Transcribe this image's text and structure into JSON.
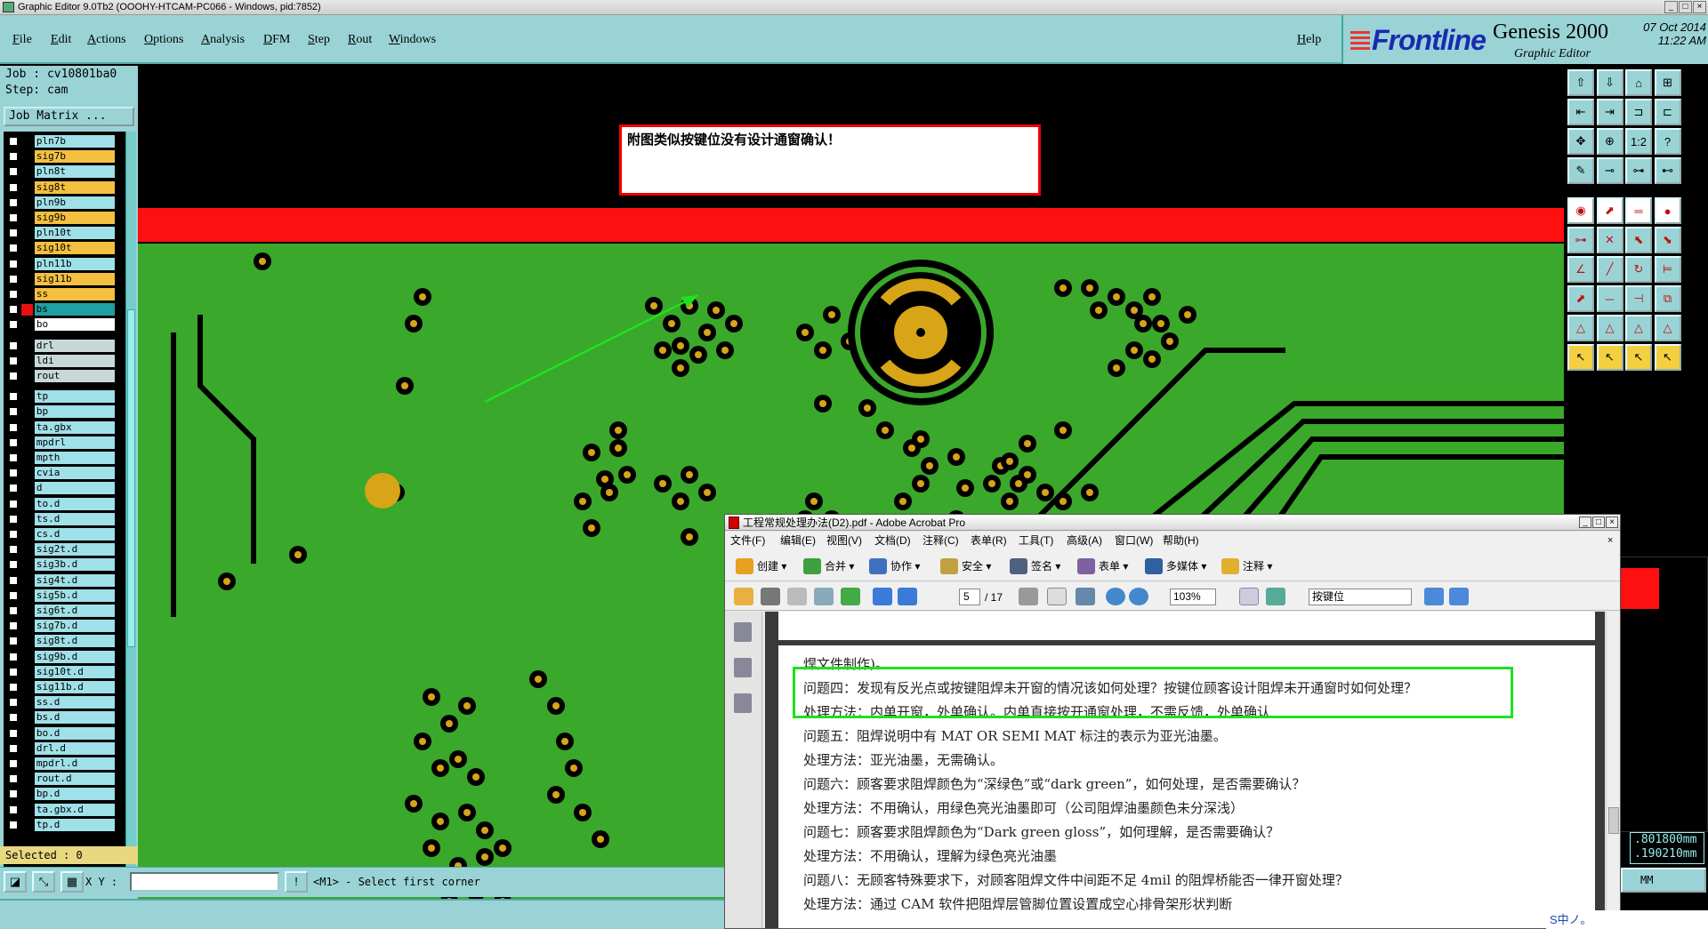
{
  "titlebar": {
    "title": "Graphic Editor 9.0Tb2 (OOOHY-HTCAM-PC066 - Windows, pid:7852)"
  },
  "menu": {
    "items": [
      "File",
      "Edit",
      "Actions",
      "Options",
      "Analysis",
      "DFM",
      "Step",
      "Rout",
      "Windows"
    ],
    "help": "Help"
  },
  "brand": {
    "logo": "Frontline",
    "product": "Genesis 2000",
    "subtitle": "Graphic Editor",
    "date": "07 Oct 2014",
    "time": "11:22 AM"
  },
  "job": {
    "job_label": "Job : cv10801ba0",
    "step_label": "Step: cam",
    "matrix_button": "Job Matrix ..."
  },
  "layers": [
    {
      "name": "pln7b",
      "color": "#a0e0e8"
    },
    {
      "name": "sig7b",
      "color": "#f4c040"
    },
    {
      "name": "pln8t",
      "color": "#a0e0e8"
    },
    {
      "name": "sig8t",
      "color": "#f4c040"
    },
    {
      "name": "pln9b",
      "color": "#a0e0e8"
    },
    {
      "name": "sig9b",
      "color": "#f4c040"
    },
    {
      "name": "pln10t",
      "color": "#a0e0e8"
    },
    {
      "name": "sig10t",
      "color": "#f4c040"
    },
    {
      "name": "pln11b",
      "color": "#a0e0e8"
    },
    {
      "name": "sig11b",
      "color": "#f4c040"
    },
    {
      "name": "ss",
      "color": "#f4c040"
    },
    {
      "name": "bs",
      "color": "#20a0a0"
    },
    {
      "name": "bo",
      "color": "#ffffff"
    },
    {
      "name": "drl",
      "color": "#c8d8d8"
    },
    {
      "name": "ldi",
      "color": "#c8d8d8"
    },
    {
      "name": "rout",
      "color": "#c8d8d8"
    },
    {
      "name": "tp",
      "color": "#a0e0e8"
    },
    {
      "name": "bp",
      "color": "#a0e0e8"
    },
    {
      "name": "ta.gbx",
      "color": "#a0e0e8"
    },
    {
      "name": "mpdrl",
      "color": "#a0e0e8"
    },
    {
      "name": "mpth",
      "color": "#a0e0e8"
    },
    {
      "name": "cvia",
      "color": "#a0e0e8"
    },
    {
      "name": "d",
      "color": "#a0e0e8"
    },
    {
      "name": "to.d",
      "color": "#a0e0e8"
    },
    {
      "name": "ts.d",
      "color": "#a0e0e8"
    },
    {
      "name": "cs.d",
      "color": "#a0e0e8"
    },
    {
      "name": "sig2t.d",
      "color": "#a0e0e8"
    },
    {
      "name": "sig3b.d",
      "color": "#a0e0e8"
    },
    {
      "name": "sig4t.d",
      "color": "#a0e0e8"
    },
    {
      "name": "sig5b.d",
      "color": "#a0e0e8"
    },
    {
      "name": "sig6t.d",
      "color": "#a0e0e8"
    },
    {
      "name": "sig7b.d",
      "color": "#a0e0e8"
    },
    {
      "name": "sig8t.d",
      "color": "#a0e0e8"
    },
    {
      "name": "sig9b.d",
      "color": "#a0e0e8"
    },
    {
      "name": "sig10t.d",
      "color": "#a0e0e8"
    },
    {
      "name": "sig11b.d",
      "color": "#a0e0e8"
    },
    {
      "name": "ss.d",
      "color": "#a0e0e8"
    },
    {
      "name": "bs.d",
      "color": "#a0e0e8"
    },
    {
      "name": "bo.d",
      "color": "#a0e0e8"
    },
    {
      "name": "drl.d",
      "color": "#a0e0e8"
    },
    {
      "name": "mpdrl.d",
      "color": "#a0e0e8"
    },
    {
      "name": "rout.d",
      "color": "#a0e0e8"
    },
    {
      "name": "bp.d",
      "color": "#a0e0e8"
    },
    {
      "name": "ta.gbx.d",
      "color": "#a0e0e8"
    },
    {
      "name": "tp.d",
      "color": "#a0e0e8"
    }
  ],
  "selected": "Selected : 0",
  "status": {
    "xy_label": "X Y :",
    "message": "<M1> - Select first corner"
  },
  "coords": {
    "x": ".801800mm",
    "y": ".190210mm"
  },
  "units": "MM",
  "annotation": "附图类似按键位没有设计通窗确认！",
  "colors": {
    "board_green": "#3aa82a",
    "pad_gold": "#d8a418",
    "red_band": "#ff1010",
    "arrow_green": "#20e020"
  },
  "acrobat": {
    "title": "工程常规处理办法(D2).pdf - Adobe Acrobat Pro",
    "menu": [
      "文件(F)",
      "编辑(E)",
      "视图(V)",
      "文档(D)",
      "注释(C)",
      "表单(R)",
      "工具(T)",
      "高级(A)",
      "窗口(W)",
      "帮助(H)"
    ],
    "toolbar": [
      "创建",
      "合并",
      "协作",
      "安全",
      "签名",
      "表单",
      "多媒体",
      "注释"
    ],
    "page_current": "5",
    "page_total": "/ 17",
    "zoom": "103%",
    "search": "按键位",
    "lines": [
      "焊文件制作)。",
      "问题四：发现有反光点或按键阻焊未开窗的情况该如何处理？按键位顾客设计阻焊未开通窗时如何处理？",
      "处理方法：内单开窗，外单确认。内单直接按开通窗处理，不需反馈，外单确认",
      "问题五：阻焊说明中有 MAT OR SEMI MAT 标注的表示为亚光油墨。",
      "处理方法：亚光油墨，无需确认。",
      "问题六：顾客要求阻焊颜色为“深绿色”或“dark green”，如何处理，是否需要确认？",
      "处理方法：不用确认，用绿色亮光油墨即可（公司阻焊油墨颜色未分深浅）",
      "问题七：顾客要求阻焊颜色为“Dark green gloss”，如何理解，是否需要确认？",
      "处理方法：不用确认，理解为绿色亮光油墨",
      "问题八：无顾客特殊要求下，对顾客阻焊文件中间距不足 4mil 的阻焊桥能否一律开窗处理？",
      "处理方法：通过 CAM 软件把阻焊层管脚位置设置成空心排骨架形状判断"
    ]
  },
  "tray": "S中ノ。"
}
